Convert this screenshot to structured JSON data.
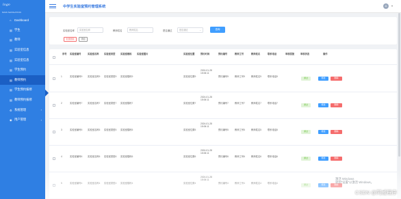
{
  "sidebar": {
    "logo": "logo",
    "caption": "MAIN NAVIGATION",
    "items": [
      {
        "label": "Dashboard",
        "icon": "home-icon"
      },
      {
        "label": "学生",
        "icon": "list-icon"
      },
      {
        "label": "教师",
        "icon": "list-icon"
      },
      {
        "label": "实验室信息",
        "icon": "list-icon"
      },
      {
        "label": "实验室信息",
        "icon": "list-icon"
      },
      {
        "label": "学生预约",
        "icon": "list-icon"
      },
      {
        "label": "教师预约",
        "icon": "list-icon"
      },
      {
        "label": "学生预约报修",
        "icon": "list-icon"
      },
      {
        "label": "教师预约报修",
        "icon": "list-icon"
      },
      {
        "label": "系统管理",
        "icon": "gear-icon",
        "chevron": "›"
      },
      {
        "label": "用户管理",
        "icon": "user-icon",
        "chevron": "›"
      }
    ]
  },
  "topbar": {
    "title": "中学生实验室预约管理系统",
    "avatar_letter": "A",
    "caret": "▾"
  },
  "filters": {
    "lab_name_label": "实验室名称",
    "lab_name_placeholder": "实验室名称",
    "teacher_name_label": "教师姓名",
    "teacher_name_placeholder": "教师姓名",
    "approved_label": "是否通过",
    "approved_placeholder": "是否通过",
    "search_button": "查询",
    "bulk_delete_button": "批量删除",
    "add_button": "添加"
  },
  "table": {
    "headers": [
      "序号",
      "实验室编号",
      "实验室名称",
      "实验室类型",
      "实验室楼栋",
      "实验室图片",
      "实验室位置",
      "预约时间",
      "预约编号",
      "教师工号",
      "教师姓名",
      "联系电话",
      "审核回复",
      "审核状态",
      "操作"
    ],
    "rows": [
      {
        "no": "1",
        "code": "实验室编号9",
        "name": "实验室名称9",
        "type": "实验室类型9",
        "building": "实验室楼栋9",
        "location": "实验室位置9",
        "time": "2024-01-28 15:06:11",
        "booking": "预约编号9",
        "tid": "教师工号9",
        "tname": "教师姓名9",
        "phone": "联系电话9",
        "status": "通过",
        "edit": "修改",
        "del": "删除"
      },
      {
        "no": "2",
        "code": "实验室编号7",
        "name": "实验室名称7",
        "type": "实验室类型7",
        "building": "实验室楼栋7",
        "location": "实验室位置7",
        "time": "2024-01-28 15:06:11",
        "booking": "预约编号7",
        "tid": "教师工号7",
        "tname": "教师姓名7",
        "phone": "联系电话7",
        "status": "通过",
        "edit": "修改",
        "del": "删除"
      },
      {
        "no": "3",
        "code": "实验室编号5",
        "name": "实验室名称5",
        "type": "实验室类型5",
        "building": "实验室楼栋5",
        "location": "实验室位置5",
        "time": "2024-01-28 15:06:11",
        "booking": "预约编号5",
        "tid": "教师工号5",
        "tname": "教师姓名5",
        "phone": "联系电话5",
        "status": "通过",
        "edit": "修改",
        "del": "删除"
      },
      {
        "no": "4",
        "code": "实验室编号6",
        "name": "实验室名称6",
        "type": "实验室类型6",
        "building": "实验室楼栋6",
        "location": "实验室位置6",
        "time": "2024-01-28 15:06:11",
        "booking": "预约编号6",
        "tid": "教师工号6",
        "tname": "教师姓名6",
        "phone": "联系电话6",
        "status": "通过",
        "edit": "修改",
        "del": "删除"
      },
      {
        "no": "5",
        "code": "实验室编号4",
        "name": "实验室名称4",
        "type": "实验室类型4",
        "building": "实验室楼栋4",
        "location": "实验室位置4",
        "time": "2024-01-28 15:06:11",
        "booking": "预约编号4",
        "tid": "教师工号4",
        "tname": "教师姓名4",
        "phone": "联系电话4",
        "status": "通过",
        "edit": "修改",
        "del": "删除"
      }
    ]
  },
  "watermarks": {
    "activate_line1": "激活 Windows",
    "activate_line2": "转到“设置”以激活 Windows。",
    "csdn": "CSDN @阿威程序"
  },
  "colors": {
    "sidebar": "#2f7fe3",
    "sidebar_active": "#1b5fc4",
    "primary": "#409eff",
    "danger": "#f56c6c",
    "success": "#67c23a"
  }
}
